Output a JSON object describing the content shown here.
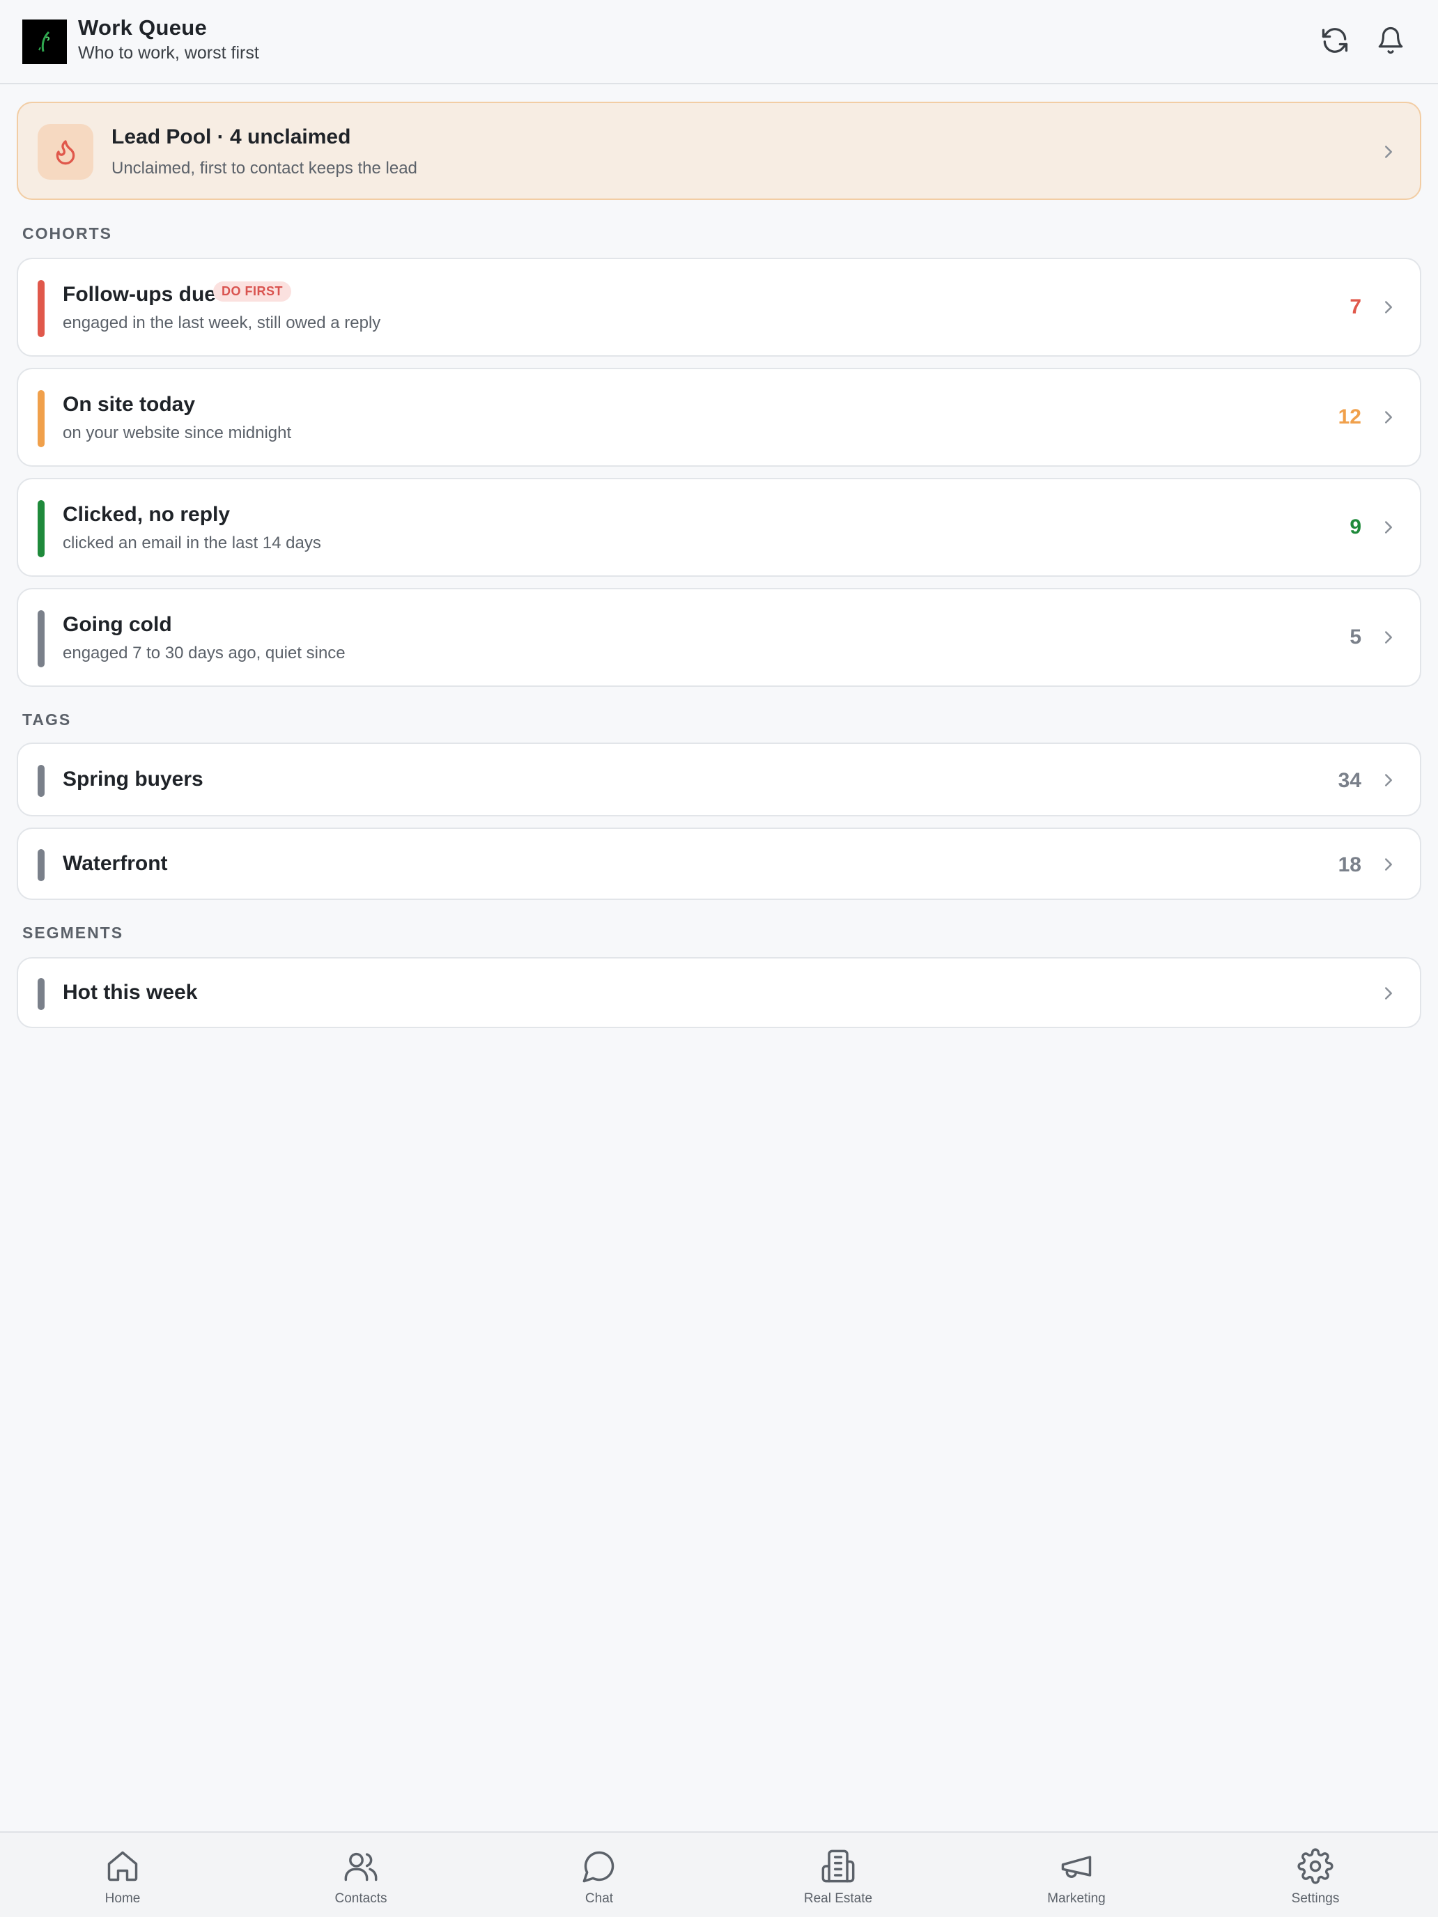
{
  "header": {
    "title": "Work Queue",
    "subtitle": "Who to work, worst first",
    "logo_icon": "leaf-logo",
    "actions": [
      "refresh-icon",
      "bell-icon"
    ]
  },
  "lead_pool": {
    "title": "Lead Pool · 4 unclaimed",
    "subtitle": "Unclaimed, first to contact keeps the lead",
    "icon": "flame-icon",
    "accent": "#e0584b"
  },
  "sections": {
    "cohorts": "COHORTS",
    "tags": "TAGS",
    "segments": "SEGMENTS"
  },
  "cohorts": [
    {
      "title": "Follow-ups due",
      "badge": "DO FIRST",
      "subtitle": "engaged in the last week, still owed a reply",
      "count": "7",
      "color": "#e0584b"
    },
    {
      "title": "On site today",
      "subtitle": "on your website since midnight",
      "count": "12",
      "color": "#f0a04b"
    },
    {
      "title": "Clicked, no reply",
      "subtitle": "clicked an email in the last 14 days",
      "count": "9",
      "color": "#1f8a3b"
    },
    {
      "title": "Going cold",
      "subtitle": "engaged 7 to 30 days ago, quiet since",
      "count": "5",
      "color": "#7a808a"
    }
  ],
  "tags": [
    {
      "title": "Spring buyers",
      "count": "34",
      "color": "#7a808a"
    },
    {
      "title": "Waterfront",
      "count": "18",
      "color": "#7a808a"
    }
  ],
  "segments": [
    {
      "title": "Hot this week",
      "color": "#7a808a"
    }
  ],
  "nav": [
    {
      "label": "Home",
      "icon": "home-icon"
    },
    {
      "label": "Contacts",
      "icon": "contacts-icon"
    },
    {
      "label": "Chat",
      "icon": "chat-icon"
    },
    {
      "label": "Real Estate",
      "icon": "building-icon"
    },
    {
      "label": "Marketing",
      "icon": "megaphone-icon"
    },
    {
      "label": "Settings",
      "icon": "gear-icon"
    }
  ]
}
